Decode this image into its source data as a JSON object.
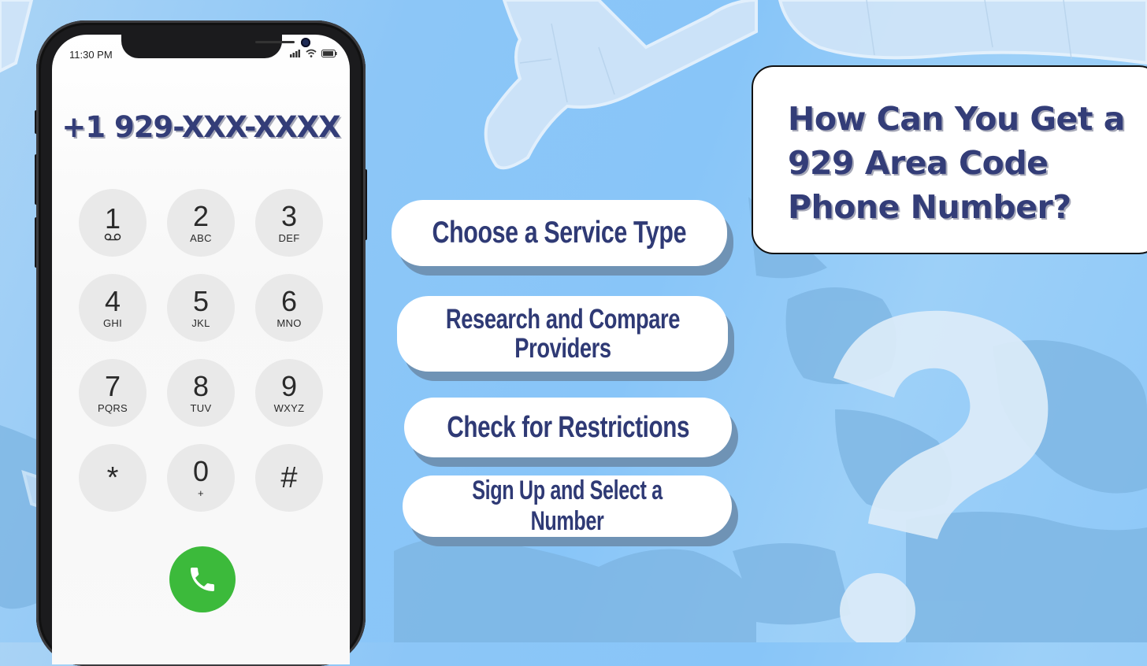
{
  "phone": {
    "status_bar": {
      "time": "11:30 PM",
      "icons": [
        "signal-icon",
        "wifi-icon",
        "battery-icon"
      ]
    },
    "dialed_number": "+1 929-XXX-XXXX",
    "keypad": [
      {
        "digit": "1",
        "letters": "",
        "sub_icon": "voicemail-icon"
      },
      {
        "digit": "2",
        "letters": "ABC"
      },
      {
        "digit": "3",
        "letters": "DEF"
      },
      {
        "digit": "4",
        "letters": "GHI"
      },
      {
        "digit": "5",
        "letters": "JKL"
      },
      {
        "digit": "6",
        "letters": "MNO"
      },
      {
        "digit": "7",
        "letters": "PQRS"
      },
      {
        "digit": "8",
        "letters": "TUV"
      },
      {
        "digit": "9",
        "letters": "WXYZ"
      },
      {
        "digit": "*",
        "letters": ""
      },
      {
        "digit": "0",
        "letters": "+"
      },
      {
        "digit": "#",
        "letters": ""
      }
    ],
    "call_button_icon": "phone-handset-icon",
    "call_button_color": "#3cba3b"
  },
  "steps": [
    {
      "label": "Choose a Service Type"
    },
    {
      "label_line1": "Research and Compare",
      "label_line2": "Providers"
    },
    {
      "label": "Check for Restrictions"
    },
    {
      "label": "Sign Up and Select a Number"
    }
  ],
  "title": {
    "line1": "How Can You Get a",
    "line2": "929 Area Code",
    "line3": "Phone Number?"
  },
  "decor": {
    "background_icon": "world-map",
    "big_symbol": "question-mark-icon"
  },
  "colors": {
    "text_navy": "#2f3a75",
    "background_blue": "#88c5f8",
    "step_shadow": "#6f93b5"
  }
}
